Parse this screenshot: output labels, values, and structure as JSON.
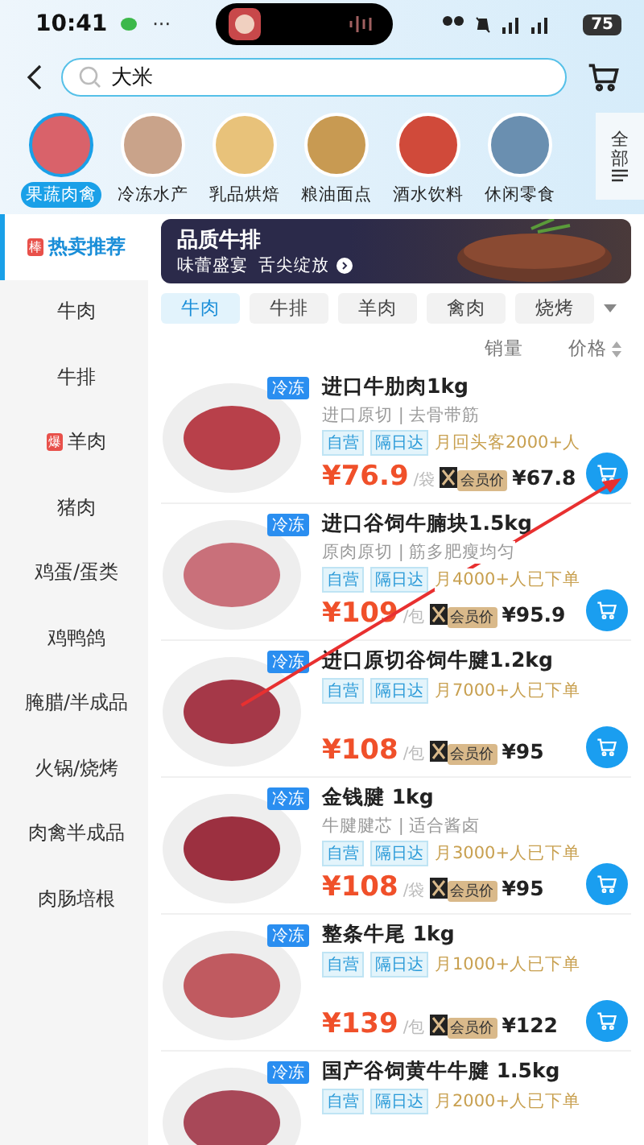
{
  "status_bar": {
    "time": "10:41",
    "dots": "···",
    "battery": "75"
  },
  "search": {
    "value": "大米"
  },
  "categories": [
    {
      "label": "果蔬肉禽",
      "selected": true,
      "color": "#d9626a"
    },
    {
      "label": "冷冻水产",
      "selected": false,
      "color": "#c9a38a"
    },
    {
      "label": "乳品烘焙",
      "selected": false,
      "color": "#e8c27a"
    },
    {
      "label": "粮油面点",
      "selected": false,
      "color": "#c89a52"
    },
    {
      "label": "酒水饮料",
      "selected": false,
      "color": "#d04a3a"
    },
    {
      "label": "休闲零食",
      "selected": false,
      "color": "#6a8fb0"
    }
  ],
  "all_button": {
    "label": "全部"
  },
  "sidebar": [
    {
      "label": "热卖推荐",
      "selected": true,
      "badge": "棒"
    },
    {
      "label": "牛肉",
      "selected": false
    },
    {
      "label": "牛排",
      "selected": false
    },
    {
      "label": "羊肉",
      "selected": false,
      "badge": "爆"
    },
    {
      "label": "猪肉",
      "selected": false
    },
    {
      "label": "鸡蛋/蛋类",
      "selected": false
    },
    {
      "label": "鸡鸭鸽",
      "selected": false
    },
    {
      "label": "腌腊/半成品",
      "selected": false
    },
    {
      "label": "火锅/烧烤",
      "selected": false
    },
    {
      "label": "肉禽半成品",
      "selected": false
    },
    {
      "label": "肉肠培根",
      "selected": false
    }
  ],
  "banner": {
    "title": "品质牛排",
    "subtitle": "味蕾盛宴  舌尖绽放"
  },
  "chips": [
    {
      "label": "牛肉",
      "selected": true
    },
    {
      "label": "牛排",
      "selected": false
    },
    {
      "label": "羊肉",
      "selected": false
    },
    {
      "label": "禽肉",
      "selected": false
    },
    {
      "label": "烧烤",
      "selected": false
    }
  ],
  "sort": [
    {
      "label": "销量",
      "kind": "plain"
    },
    {
      "label": "价格",
      "kind": "toggle"
    }
  ],
  "products": [
    {
      "tag": "冷冻",
      "title": "进口牛肋肉1kg",
      "subtitle": "进口原切 | 去骨带筋",
      "badges": [
        "自营",
        "隔日达"
      ],
      "note": "月回头客2000+人",
      "price": "¥76.9",
      "unit": "/袋",
      "member_label": "会员价",
      "member_price": "¥67.8",
      "color": "#b8404a"
    },
    {
      "tag": "冷冻",
      "title": "进口谷饲牛腩块1.5kg",
      "subtitle": "原肉原切 | 筋多肥瘦均匀",
      "badges": [
        "自营",
        "隔日达"
      ],
      "note": "月4000+人已下单",
      "price": "¥109",
      "unit": "/包",
      "member_label": "会员价",
      "member_price": "¥95.9",
      "color": "#c9707a"
    },
    {
      "tag": "冷冻",
      "title": "进口原切谷饲牛腱1.2kg",
      "badges": [
        "自营",
        "隔日达"
      ],
      "note": "月7000+人已下单",
      "price": "¥108",
      "unit": "/包",
      "member_label": "会员价",
      "member_price": "¥95",
      "color": "#a53848"
    },
    {
      "tag": "冷冻",
      "title": "金钱腱 1kg",
      "subtitle": "牛腱腱芯 | 适合酱卤",
      "badges": [
        "自营",
        "隔日达"
      ],
      "note": "月3000+人已下单",
      "price": "¥108",
      "unit": "/袋",
      "member_label": "会员价",
      "member_price": "¥95",
      "color": "#9c3040"
    },
    {
      "tag": "冷冻",
      "title": "整条牛尾 1kg",
      "badges": [
        "自营",
        "隔日达"
      ],
      "note": "月1000+人已下单",
      "price": "¥139",
      "unit": "/包",
      "member_label": "会员价",
      "member_price": "¥122",
      "color": "#c05a60"
    },
    {
      "tag": "冷冻",
      "title": "国产谷饲黄牛牛腱 1.5kg",
      "badges": [
        "自营",
        "隔日达"
      ],
      "note": "月2000+人已下单",
      "color": "#a84858"
    }
  ]
}
